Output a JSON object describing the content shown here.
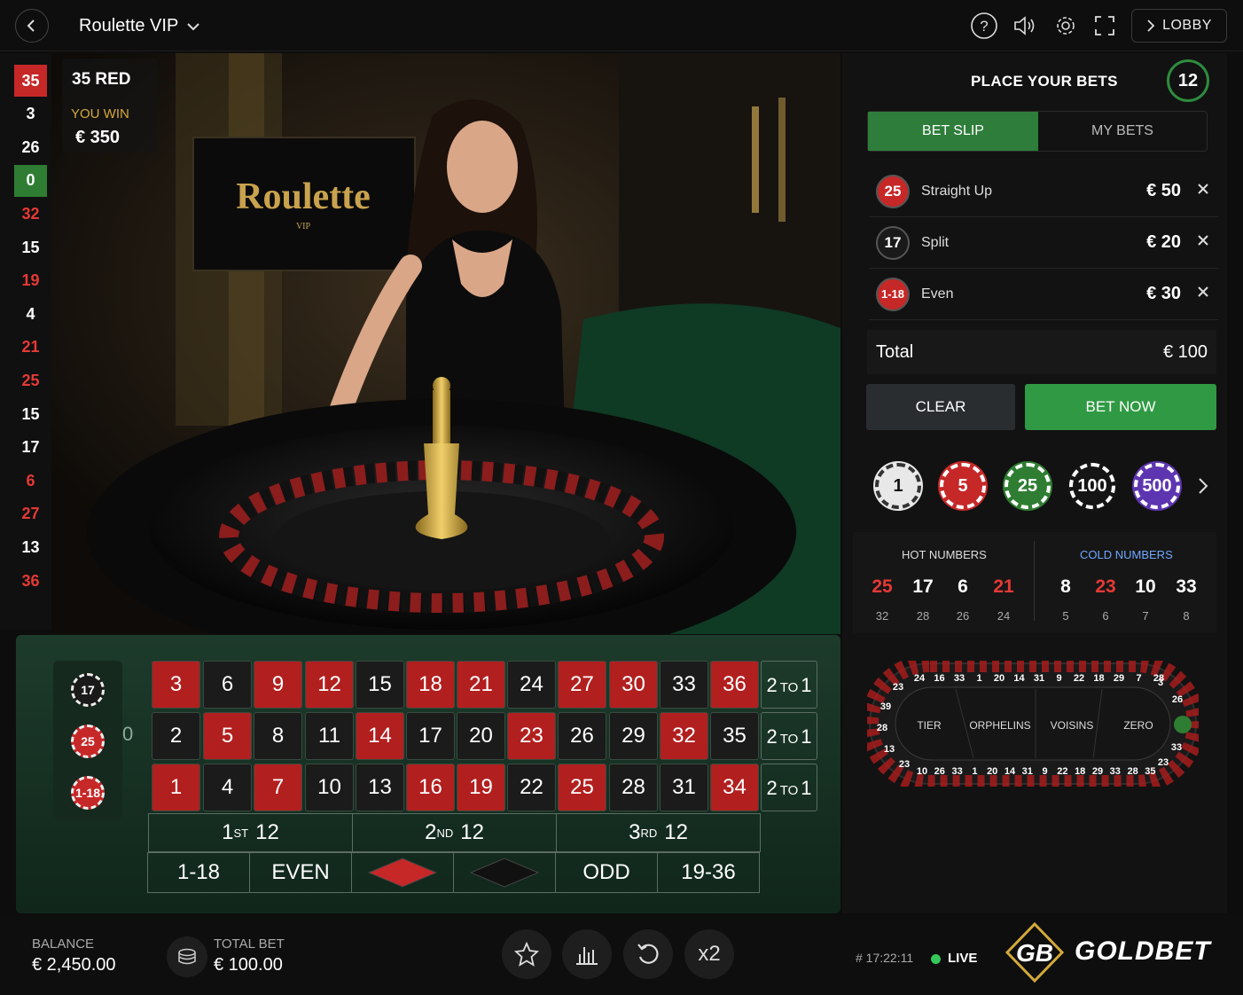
{
  "header": {
    "title": "Roulette VIP",
    "lobby_label": "LOBBY"
  },
  "history": [
    {
      "v": "35",
      "c": "bg-red"
    },
    {
      "v": "3",
      "c": "black"
    },
    {
      "v": "26",
      "c": "black"
    },
    {
      "v": "0",
      "c": "bg-green"
    },
    {
      "v": "32",
      "c": "red"
    },
    {
      "v": "15",
      "c": "black"
    },
    {
      "v": "19",
      "c": "red"
    },
    {
      "v": "4",
      "c": "black"
    },
    {
      "v": "21",
      "c": "red"
    },
    {
      "v": "25",
      "c": "red"
    },
    {
      "v": "15",
      "c": "black"
    },
    {
      "v": "17",
      "c": "black"
    },
    {
      "v": "6",
      "c": "red"
    },
    {
      "v": "27",
      "c": "red"
    },
    {
      "v": "13",
      "c": "black"
    },
    {
      "v": "36",
      "c": "red"
    }
  ],
  "result": {
    "number_text": "35 RED",
    "win_label": "YOU WIN",
    "win_amount": "€ 350"
  },
  "video": {
    "sign_text": "Roulette",
    "sign_sub": "VIP"
  },
  "panel": {
    "title": "PLACE YOUR BETS",
    "timer": "12",
    "tabs": [
      "BET SLIP",
      "MY BETS"
    ],
    "slip": [
      {
        "num": "25",
        "type": "Straight Up",
        "amount": "€ 50",
        "color": "#c62828"
      },
      {
        "num": "17",
        "type": "Split",
        "amount": "€ 20",
        "color": "#1a1a1a"
      },
      {
        "num": "1-18",
        "type": "Even",
        "amount": "€ 30",
        "color": "#c62828"
      }
    ],
    "total_label": "Total",
    "total_value": "€ 100",
    "clear_label": "CLEAR",
    "bet_now_label": "BET NOW",
    "chips": [
      {
        "v": "1",
        "bg": "#e8e8e8",
        "fg": "#111"
      },
      {
        "v": "5",
        "bg": "#c62828",
        "fg": "#fff"
      },
      {
        "v": "25",
        "bg": "#2e7d32",
        "fg": "#fff"
      },
      {
        "v": "100",
        "bg": "#151515",
        "fg": "#fff"
      },
      {
        "v": "500",
        "bg": "#5e35b1",
        "fg": "#fff"
      }
    ],
    "hot_label": "HOT NUMBERS",
    "cold_label": "COLD NUMBERS",
    "hot": [
      {
        "n": "25",
        "count": "32",
        "c": "#e53935"
      },
      {
        "n": "17",
        "count": "28",
        "c": "#fff"
      },
      {
        "n": "6",
        "count": "26",
        "c": "#fff"
      },
      {
        "n": "21",
        "count": "24",
        "c": "#e53935"
      }
    ],
    "cold": [
      {
        "n": "8",
        "count": "5",
        "c": "#fff"
      },
      {
        "n": "23",
        "count": "6",
        "c": "#e53935"
      },
      {
        "n": "10",
        "count": "7",
        "c": "#fff"
      },
      {
        "n": "33",
        "count": "8",
        "c": "#fff"
      }
    ],
    "racetrack": {
      "sections": [
        "TIER",
        "ORPHELINS",
        "VOISINS",
        "ZERO"
      ],
      "top": [
        "24",
        "16",
        "33",
        "1",
        "20",
        "14",
        "31",
        "9",
        "22",
        "18",
        "29",
        "7",
        "28"
      ],
      "bottom": [
        "10",
        "26",
        "33",
        "1",
        "20",
        "14",
        "31",
        "9",
        "22",
        "18",
        "29",
        "33",
        "28",
        "35"
      ],
      "left": [
        "23",
        "39",
        "28",
        "13",
        "23"
      ],
      "right": [
        "3",
        "26",
        "0",
        "33",
        "23"
      ]
    }
  },
  "board": {
    "zero": "0",
    "rows": [
      [
        {
          "n": "3",
          "c": "red"
        },
        {
          "n": "6",
          "c": "black"
        },
        {
          "n": "9",
          "c": "red"
        },
        {
          "n": "12",
          "c": "red"
        },
        {
          "n": "15",
          "c": "black"
        },
        {
          "n": "18",
          "c": "red"
        },
        {
          "n": "21",
          "c": "red"
        },
        {
          "n": "24",
          "c": "black"
        },
        {
          "n": "27",
          "c": "red"
        },
        {
          "n": "30",
          "c": "red"
        },
        {
          "n": "33",
          "c": "black"
        },
        {
          "n": "36",
          "c": "red"
        }
      ],
      [
        {
          "n": "2",
          "c": "black"
        },
        {
          "n": "5",
          "c": "red"
        },
        {
          "n": "8",
          "c": "black"
        },
        {
          "n": "11",
          "c": "black"
        },
        {
          "n": "14",
          "c": "red"
        },
        {
          "n": "17",
          "c": "black"
        },
        {
          "n": "20",
          "c": "black"
        },
        {
          "n": "23",
          "c": "red"
        },
        {
          "n": "26",
          "c": "black"
        },
        {
          "n": "29",
          "c": "black"
        },
        {
          "n": "32",
          "c": "red"
        },
        {
          "n": "35",
          "c": "black"
        }
      ],
      [
        {
          "n": "1",
          "c": "red"
        },
        {
          "n": "4",
          "c": "black"
        },
        {
          "n": "7",
          "c": "red"
        },
        {
          "n": "10",
          "c": "black"
        },
        {
          "n": "13",
          "c": "black"
        },
        {
          "n": "16",
          "c": "red"
        },
        {
          "n": "19",
          "c": "red"
        },
        {
          "n": "22",
          "c": "black"
        },
        {
          "n": "25",
          "c": "red"
        },
        {
          "n": "28",
          "c": "black"
        },
        {
          "n": "31",
          "c": "black"
        },
        {
          "n": "34",
          "c": "red"
        }
      ]
    ],
    "column_bet": {
      "a": "2",
      "to": "TO",
      "b": "1"
    },
    "dozens": [
      {
        "n": "1",
        "sup": "ST",
        "d": "12"
      },
      {
        "n": "2",
        "sup": "ND",
        "d": "12"
      },
      {
        "n": "3",
        "sup": "RD",
        "d": "12"
      }
    ],
    "outside": {
      "low": "1-18",
      "even": "EVEN",
      "odd": "ODD",
      "high": "19-36"
    },
    "side_chips": [
      "17",
      "25",
      "1-18"
    ]
  },
  "footer": {
    "balance_label": "BALANCE",
    "balance_value": "€ 2,450.00",
    "total_bet_label": "TOTAL BET",
    "total_bet_value": "€ 100.00",
    "x2_label": "x2",
    "round_id": "# 17:22:11",
    "live_label": "LIVE",
    "brand": "GOLDBET",
    "brand_mark": "GB"
  },
  "colors": {
    "accent_green": "#2e8b3e",
    "red": "#c62828",
    "gold": "#d4a93a"
  }
}
